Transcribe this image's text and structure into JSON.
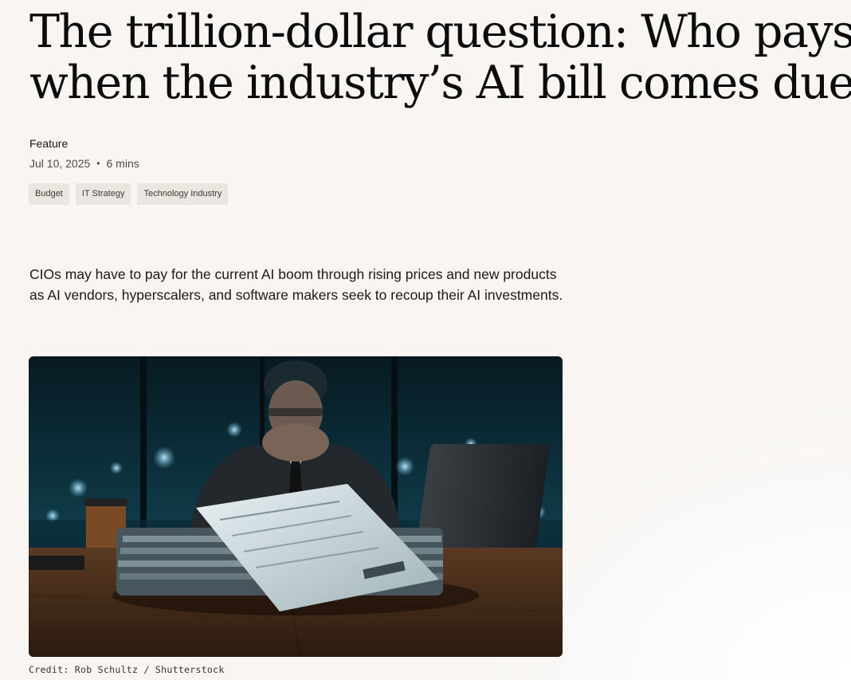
{
  "article": {
    "headline_line1": "The trillion-dollar question: Who pays",
    "headline_line2": "when the industry’s AI bill comes due?",
    "kicker": "Feature",
    "date": "Jul 10, 2025",
    "separator": "•",
    "read_time": "6 mins",
    "tags": [
      "Budget",
      "IT Strategy",
      "Technology Industry"
    ],
    "summary": "CIOs may have to pay for the current AI boom through rising prices and new products as AI vendors, hyperscalers, and software makers seek to recoup their AI investments.",
    "image_credit": "Credit: Rob Schultz / Shutterstock"
  },
  "colors": {
    "background": "#f8f5f2",
    "tag_background": "#ebe6e0",
    "text": "#111111"
  }
}
